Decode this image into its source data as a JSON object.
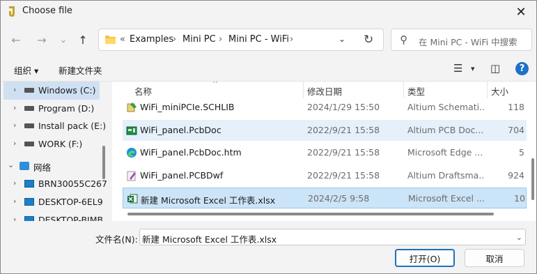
{
  "window": {
    "title": "Choose file",
    "close_glyph": "✕"
  },
  "nav": {
    "back_glyph": "←",
    "forward_glyph": "→",
    "recent_glyph": "⌄",
    "up_glyph": "↑",
    "breadcrumbs": [
      "Examples",
      "Mini PC",
      "Mini PC - WiFi"
    ],
    "overflow_glyph": "«",
    "sep_glyph": "›",
    "dropdown_glyph": "⌄",
    "refresh_glyph": "↻"
  },
  "search": {
    "placeholder": "在 Mini PC - WiFi 中搜索",
    "icon_glyph": "⚲"
  },
  "toolbar": {
    "organize_label": "组织 ▾",
    "new_folder_label": "新建文件夹",
    "view_glyph": "☰",
    "view_dd_glyph": "▾",
    "pane_glyph": "◫",
    "help_glyph": "?"
  },
  "sidebar": {
    "items": [
      {
        "label": "Windows (C:)",
        "chevron": "›",
        "icon": "drive-icon",
        "selected": true
      },
      {
        "label": "Program (D:)",
        "chevron": "›",
        "icon": "drive-icon"
      },
      {
        "label": "Install pack (E:)",
        "chevron": "›",
        "icon": "drive-icon"
      },
      {
        "label": "WORK (F:)",
        "chevron": "›",
        "icon": "drive-icon"
      },
      {
        "label": "网络",
        "chevron": "⌄",
        "icon": "network-icon"
      },
      {
        "label": "BRN30055C267",
        "chevron": "›",
        "icon": "computer-icon"
      },
      {
        "label": "DESKTOP-6EL9",
        "chevron": "›",
        "icon": "computer-icon"
      },
      {
        "label": "DESKTOP-BIMB",
        "chevron": "›",
        "icon": "computer-icon"
      }
    ]
  },
  "columns": {
    "name": "名称",
    "modified": "修改日期",
    "type": "类型",
    "size": "大小",
    "sort_glyph": "^"
  },
  "files": [
    {
      "name": "WiFi_miniPCIe.SCHLIB",
      "modified": "2024/1/29 15:50",
      "type": "Altium Schemati...",
      "size": "118",
      "icon": "schematic-lib-icon"
    },
    {
      "name": "WiFi_panel.PcbDoc",
      "modified": "2022/9/21 15:58",
      "type": "Altium PCB Doc...",
      "size": "704",
      "icon": "pcb-doc-icon",
      "state": "hover"
    },
    {
      "name": "WiFi_panel.PcbDoc.htm",
      "modified": "2022/9/21 15:58",
      "type": "Microsoft Edge ...",
      "size": "5",
      "icon": "edge-icon"
    },
    {
      "name": "WiFi_panel.PCBDwf",
      "modified": "2022/9/21 15:58",
      "type": "Altium Draftsma...",
      "size": "924",
      "icon": "draftsman-icon"
    },
    {
      "name": "新建 Microsoft Excel 工作表.xlsx",
      "modified": "2024/2/5 9:58",
      "type": "Microsoft Excel ...",
      "size": "10",
      "icon": "excel-icon",
      "state": "selected"
    }
  ],
  "footer": {
    "filename_label": "文件名(N):",
    "filename_value": "新建 Microsoft Excel 工作表.xlsx",
    "dropdown_glyph": "⌄",
    "open_label": "打开(O)",
    "cancel_label": "取消"
  }
}
